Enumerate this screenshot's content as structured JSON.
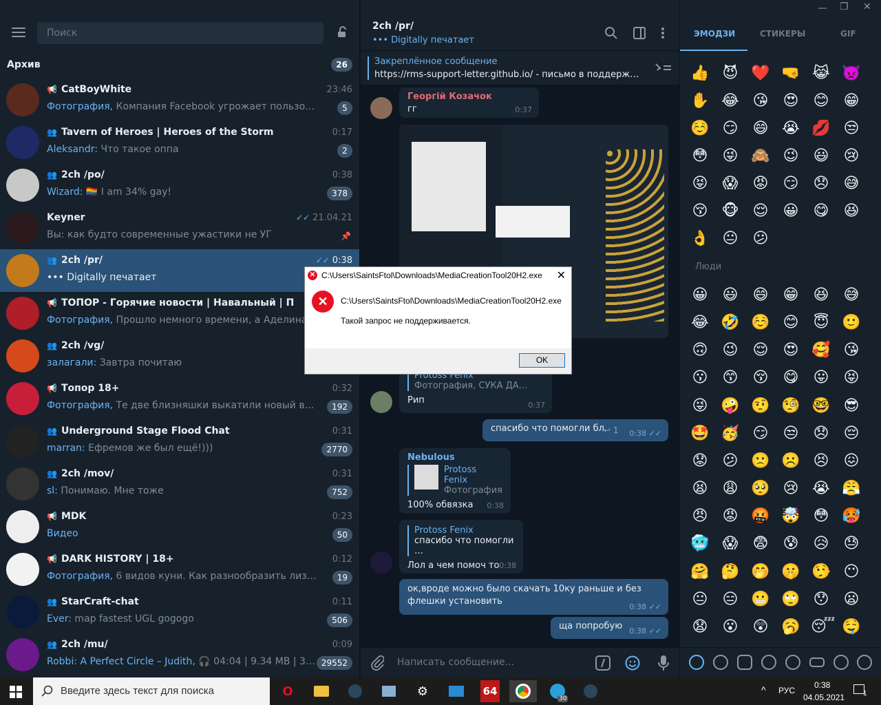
{
  "left": {
    "search_placeholder": "Поиск",
    "archive": {
      "label": "Архив",
      "count": "26"
    },
    "chats": [
      {
        "title": "CatBoyWhite",
        "kind": "channel",
        "time": "23:46",
        "who": "",
        "prev_prefix": "Фотография,",
        "preview": " Компания Facebook угрожает пользователям перев…",
        "badge": "5",
        "av": "#5b2a1e"
      },
      {
        "title": "Tavern of Heroes | Heroes of the Storm",
        "kind": "group",
        "time": "0:17",
        "who": "Aleksandr:",
        "prev_prefix": "",
        "preview": " Что такое оппа",
        "badge": "2",
        "av": "#1e2a66"
      },
      {
        "title": "2ch /po/",
        "kind": "group",
        "time": "0:38",
        "who": "Wizard:",
        "prev_prefix": "",
        "preview": " 🏳️‍🌈 I am 34% gay!",
        "badge": "378",
        "av": "#c8c8c8"
      },
      {
        "title": "Keyner",
        "kind": "user",
        "time": "21.04.21",
        "who": "",
        "prev_prefix": "",
        "preview": "Вы: как будто современные ужастики не УГ",
        "badge": "",
        "av": "#2a1a1e"
      },
      {
        "title": "2ch /pr/",
        "kind": "group",
        "time": "0:38",
        "who": "",
        "prev_prefix": "",
        "preview": "••• Digitally печатает",
        "badge": "",
        "av": "#c27a1a"
      },
      {
        "title": "ТОПОР - Горячие новости | Навальный | Протесты",
        "kind": "channel",
        "time": "",
        "who": "",
        "prev_prefix": "Фотография,",
        "preview": " Прошло немного времени, а Аделина и Алина",
        "badge": "",
        "av": "#b01e2a"
      },
      {
        "title": "2ch /vg/",
        "kind": "group",
        "time": "",
        "who": "залагали:",
        "prev_prefix": "",
        "preview": " Завтра почитаю",
        "badge": "",
        "av": "#d44a1a"
      },
      {
        "title": "Топор 18+",
        "kind": "channel",
        "time": "0:32",
        "who": "",
        "prev_prefix": "Фотография,",
        "preview": " Те две близняшки выкатили новый видос, на кото…",
        "badge": "192",
        "av": "#c81e3a"
      },
      {
        "title": "Underground Stage Flood Chat",
        "kind": "group",
        "time": "0:31",
        "who": "marran:",
        "prev_prefix": "",
        "preview": " Ефремов же был ещё!)))",
        "badge": "2770",
        "av": "#222"
      },
      {
        "title": "2ch /mov/",
        "kind": "group",
        "time": "0:31",
        "who": "sl:",
        "prev_prefix": "",
        "preview": " Понимаю. Мне тоже",
        "badge": "752",
        "av": "#333"
      },
      {
        "title": "MDK",
        "kind": "channel",
        "time": "0:23",
        "who": "",
        "prev_prefix": "Видео",
        "preview": "",
        "badge": "50",
        "av": "#eee"
      },
      {
        "title": "DARK HISTORY | 18+",
        "kind": "channel",
        "time": "0:12",
        "who": "",
        "prev_prefix": "Фотография,",
        "preview": " 6 видов куни. Как разнообразить лизание  1.Мягки…",
        "badge": "19",
        "av": "#f2f2f2"
      },
      {
        "title": "StarCraft-chat",
        "kind": "group",
        "time": "0:11",
        "who": "Ever:",
        "prev_prefix": "",
        "preview": " map fastest UGL gogogo",
        "badge": "506",
        "av": "#0a1a3a"
      },
      {
        "title": "2ch /mu/",
        "kind": "group",
        "time": "0:09",
        "who": "Robbi: A Perfect Circle – Judith,",
        "prev_prefix": "",
        "preview": " 🎧 04:04 | 9.34 MB | 321 Kbps via …",
        "badge": "29552",
        "av": "#6a1a8a"
      }
    ]
  },
  "mid": {
    "title": "2ch /pr/",
    "status": "••• Digitally печатает",
    "pinned_label": "Закреплённое сообщение",
    "pinned_text": "https://rms-support-letter.github.io/ - письмо в поддержку Ст…",
    "msgs": {
      "m1_name": "Георгій Козачок",
      "m1_text": "гг",
      "m1_time": "0:37",
      "m2_reply_name": "Protoss Fenix",
      "m2_reply_text": "Фотография, СУКА ДА…",
      "m2_text": "Рип",
      "m2_time": "0:37",
      "m3_text": "спасибо что помогли бл",
      "m3_replies": "1",
      "m3_time": "0:38",
      "m4_name": "Nebulous",
      "m4_reply_name": "Protoss Fenix",
      "m4_reply_text": "Фотография",
      "m4_text": "100% обвязка",
      "m4_time": "0:38",
      "m5_reply_name": "Protoss Fenix",
      "m5_reply_text": "спасибо что помогли …",
      "m5_text": "Лол а чем помоч то",
      "m5_time": "0:38",
      "m6_text": "ок,вроде можно было скачать 10ку раньше и без флешки установить",
      "m6_time": "0:38",
      "m7_text": "ща попробую",
      "m7_time": "0:38"
    },
    "compose_placeholder": "Написать сообщение..."
  },
  "right": {
    "tabs": [
      "ЭМОДЗИ",
      "СТИКЕРЫ",
      "GIF"
    ],
    "people_label": "Люди",
    "emoji_top": [
      "👍",
      "😈",
      "❤️",
      "🤜",
      "😹",
      "👿",
      "✋",
      "😂",
      "😘",
      "😍",
      "😊",
      "😁",
      "☺️",
      "😏",
      "😄",
      "😭",
      "💋",
      "😒",
      "😳",
      "😜",
      "🙈",
      "😉",
      "😃",
      "😢",
      "😝",
      "😱",
      "😡",
      "😏",
      "😞",
      "😅",
      "😚",
      "🐵",
      "😌",
      "😀",
      "😋",
      "😆",
      "👌",
      "😐",
      "😕"
    ],
    "emoji_people": [
      "😀",
      "😃",
      "😄",
      "😁",
      "😆",
      "😅",
      "😂",
      "🤣",
      "☺️",
      "😊",
      "😇",
      "🙂",
      "🙃",
      "😉",
      "😌",
      "😍",
      "🥰",
      "😘",
      "😗",
      "😙",
      "😚",
      "😋",
      "😛",
      "😝",
      "😜",
      "🤪",
      "🤨",
      "🧐",
      "🤓",
      "😎",
      "🤩",
      "🥳",
      "😏",
      "😒",
      "😞",
      "😔",
      "😟",
      "😕",
      "🙁",
      "☹️",
      "😣",
      "😖",
      "😫",
      "😩",
      "🥺",
      "😢",
      "😭",
      "😤",
      "😠",
      "😡",
      "🤬",
      "🤯",
      "😳",
      "🥵",
      "🥶",
      "😱",
      "😨",
      "😰",
      "😥",
      "😓",
      "🤗",
      "🤔",
      "🤭",
      "🤫",
      "🤥",
      "😶",
      "😐",
      "😑",
      "😬",
      "🙄",
      "😯",
      "😦",
      "😧",
      "😮",
      "😲",
      "🥱",
      "😴",
      "🤤"
    ]
  },
  "dialog": {
    "title": "C:\\Users\\SaintsFtol\\Downloads\\MediaCreationTool20H2.exe",
    "path": "C:\\Users\\SaintsFtol\\Downloads\\MediaCreationTool20H2.exe",
    "message": "Такой запрос не поддерживается.",
    "ok": "OK"
  },
  "taskbar": {
    "search_placeholder": "Введите здесь текст для поиска",
    "lang": "РУС",
    "time": "0:38",
    "date": "04.05.2021",
    "notif": "1",
    "telegram_badge": "30"
  },
  "colors": {
    "accent": "#6ab3f3",
    "selected": "#2b5278",
    "bg": "#0e1621",
    "panel": "#17212b"
  }
}
